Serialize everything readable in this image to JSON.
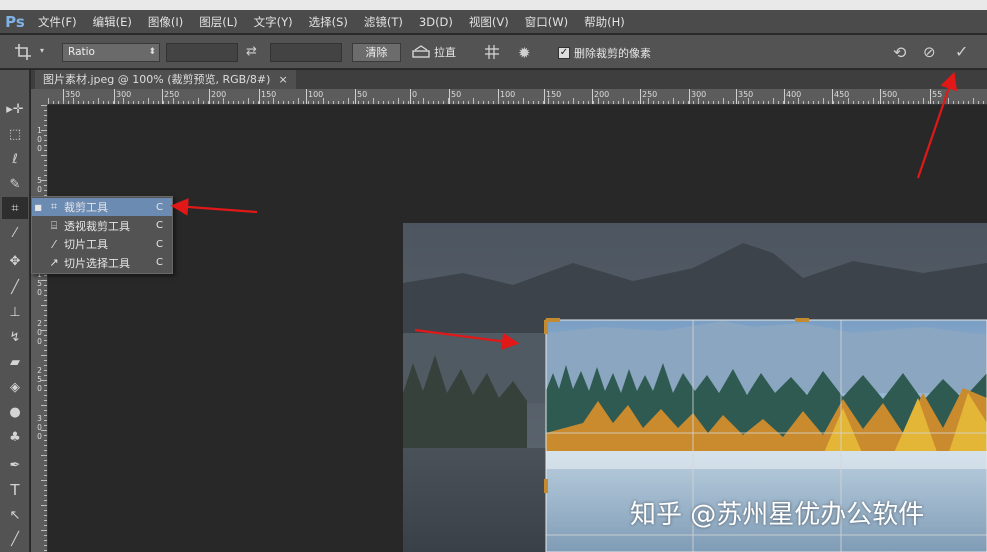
{
  "app": {
    "logo": "Ps",
    "menus": [
      "文件(F)",
      "编辑(E)",
      "图像(I)",
      "图层(L)",
      "文字(Y)",
      "选择(S)",
      "滤镜(T)",
      "3D(D)",
      "视图(V)",
      "窗口(W)",
      "帮助(H)"
    ]
  },
  "options": {
    "ratio_value": "Ratio",
    "clear_label": "清除",
    "straighten_label": "拉直",
    "delete_cropped_label": "删除裁剪的像素",
    "delete_cropped_checked": true
  },
  "document": {
    "tab_title": "图片素材.jpeg @ 100% (裁剪预览, RGB/8#)",
    "tab_close": "×"
  },
  "rulers": {
    "horizontal": [
      "350",
      "300",
      "250",
      "200",
      "150",
      "100",
      "50",
      "0",
      "50",
      "100",
      "150",
      "200",
      "250",
      "300",
      "350",
      "400",
      "450",
      "500",
      "55"
    ],
    "vertical": [
      [
        "1",
        "0",
        "0"
      ],
      [
        "5",
        "0"
      ],
      [
        "1",
        "0",
        "0"
      ],
      [
        "1",
        "5",
        "0"
      ],
      [
        "2",
        "0",
        "0"
      ],
      [
        "2",
        "5",
        "0"
      ],
      [
        "3",
        "0",
        "0"
      ]
    ]
  },
  "flyout": {
    "items": [
      {
        "icon": "crop-icon",
        "label": "裁剪工具",
        "key": "C",
        "selected": true
      },
      {
        "icon": "perspective-crop-icon",
        "label": "透视裁剪工具",
        "key": "C",
        "selected": false
      },
      {
        "icon": "slice-icon",
        "label": "切片工具",
        "key": "C",
        "selected": false
      },
      {
        "icon": "slice-select-icon",
        "label": "切片选择工具",
        "key": "C",
        "selected": false
      }
    ]
  },
  "watermark": "知乎 @苏州星优办公软件",
  "colors": {
    "menubar": "#4b4b4b",
    "optionsbar": "#535353",
    "canvas": "#282828",
    "selection": "#6b8bb3",
    "annotation_arrow": "#e01818"
  }
}
